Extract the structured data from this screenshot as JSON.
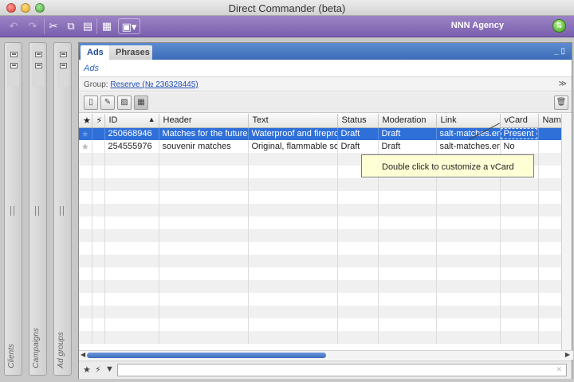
{
  "window": {
    "title": "Direct Commander (beta)"
  },
  "toolbar": {
    "agency": "NNN Agency"
  },
  "side_panels": [
    {
      "label": "Clients"
    },
    {
      "label": "Campaigns"
    },
    {
      "label": "Ad groups"
    }
  ],
  "main": {
    "tabs": [
      {
        "label": "Ads"
      },
      {
        "label": "Phrases"
      }
    ],
    "subtitle": "Ads",
    "group_prefix": "Group:",
    "group_link": "Reserve (№ 236328445)"
  },
  "table": {
    "columns": [
      "ID",
      "Header",
      "Text",
      "Status",
      "Moderation",
      "Link",
      "vCard",
      "Nam..."
    ],
    "rows": [
      {
        "id": "250668946",
        "header": "Matches for the future",
        "text": "Waterproof and fireproc",
        "status": "Draft",
        "moderation": "Draft",
        "link": "salt-matches.en",
        "vcard": "Present",
        "name": ""
      },
      {
        "id": "254555976",
        "header": "souvenir matches",
        "text": "Original, flammable sou",
        "status": "Draft",
        "moderation": "Draft",
        "link": "salt-matches.en",
        "vcard": "No",
        "name": ""
      }
    ]
  },
  "tooltip": {
    "text": "Double click to customize a vCard"
  },
  "filter": {
    "value": ""
  },
  "colors": {
    "accent": "#7a5fae",
    "tab_strip": "#3c6cb8",
    "selection": "#2f6fd8",
    "tooltip_bg": "#ffffd6"
  }
}
